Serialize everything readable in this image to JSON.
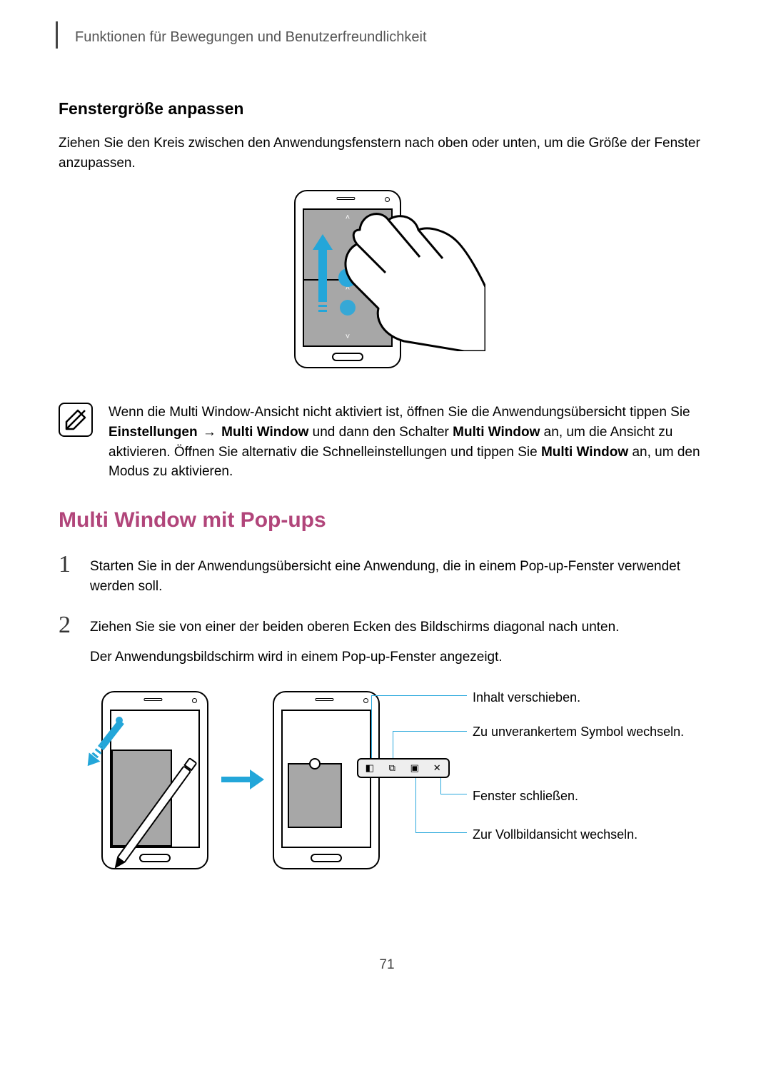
{
  "breadcrumb": "Funktionen für Bewegungen und Benutzerfreundlichkeit",
  "section1": {
    "heading": "Fenstergröße anpassen",
    "para": "Ziehen Sie den Kreis zwischen den Anwendungsfenstern nach oben oder unten, um die Größe der Fenster anzupassen."
  },
  "note": {
    "part1": "Wenn die Multi Window-Ansicht nicht aktiviert ist, öffnen Sie die Anwendungsübersicht tippen Sie ",
    "bold1": "Einstellungen",
    "arrow": " → ",
    "bold2": "Multi Window",
    "part2": " und dann den Schalter ",
    "bold3": "Multi Window",
    "part3": " an, um die Ansicht zu aktivieren. Öffnen Sie alternativ die Schnelleinstellungen und tippen Sie ",
    "bold4": "Multi Window",
    "part4": " an, um den Modus zu aktivieren."
  },
  "section2": {
    "heading": "Multi Window mit Pop-ups",
    "steps": [
      {
        "num": "1",
        "text": "Starten Sie in der Anwendungsübersicht eine Anwendung, die in einem Pop-up-Fenster verwendet werden soll."
      },
      {
        "num": "2",
        "text": "Ziehen Sie sie von einer der beiden oberen Ecken des Bildschirms diagonal nach unten.",
        "text2": "Der Anwendungsbildschirm wird in einem Pop-up-Fenster angezeigt."
      }
    ]
  },
  "callouts": {
    "c1": "Inhalt verschieben.",
    "c2": "Zu unverankertem Symbol wechseln.",
    "c3": "Fenster schließen.",
    "c4": "Zur Vollbildansicht wechseln."
  },
  "page_number": "71"
}
